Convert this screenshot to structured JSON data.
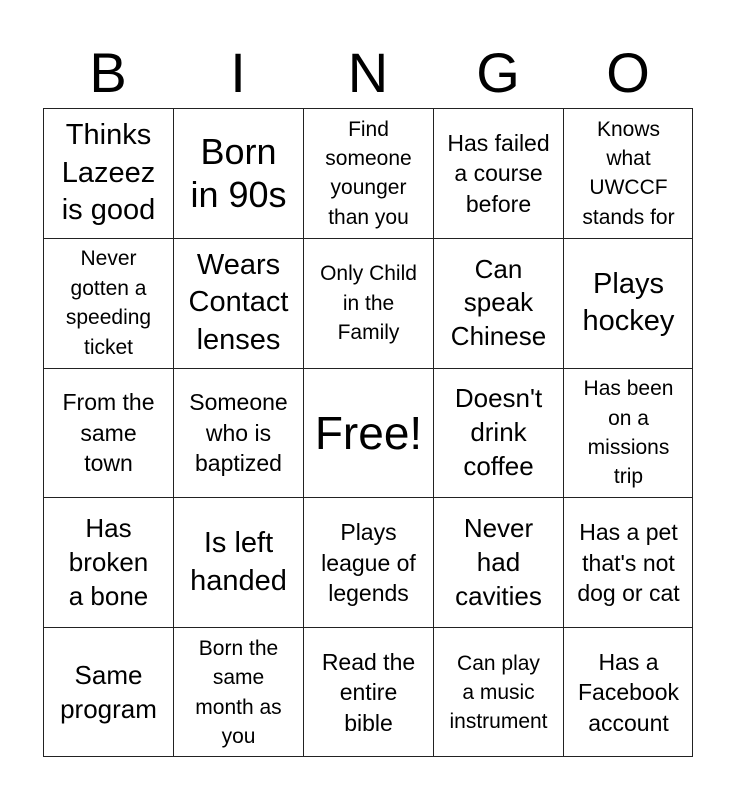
{
  "header": {
    "letters": [
      "B",
      "I",
      "N",
      "G",
      "O"
    ]
  },
  "card": {
    "cells": [
      {
        "text": "Thinks\nLazeez\nis good",
        "size": "s-ml"
      },
      {
        "text": "Born\nin 90s",
        "size": "s-l"
      },
      {
        "text": "Find\nsomeone\nyounger\nthan you",
        "size": "s-xs"
      },
      {
        "text": "Has failed\na course\nbefore",
        "size": "s-s"
      },
      {
        "text": "Knows\nwhat\nUWCCF\nstands for",
        "size": "s-xs"
      },
      {
        "text": "Never\ngotten a\nspeeding\nticket",
        "size": "s-xs"
      },
      {
        "text": "Wears\nContact\nlenses",
        "size": "s-ml"
      },
      {
        "text": "Only Child\nin the\nFamily",
        "size": "s-xs"
      },
      {
        "text": "Can\nspeak\nChinese",
        "size": "s-m"
      },
      {
        "text": "Plays\nhockey",
        "size": "s-ml"
      },
      {
        "text": "From the\nsame\ntown",
        "size": "s-s"
      },
      {
        "text": "Someone\nwho is\nbaptized",
        "size": "s-s"
      },
      {
        "text": "Free!",
        "size": "s-xl"
      },
      {
        "text": "Doesn't\ndrink\ncoffee",
        "size": "s-m"
      },
      {
        "text": "Has been\non a\nmissions\ntrip",
        "size": "s-xs"
      },
      {
        "text": "Has\nbroken\na bone",
        "size": "s-m"
      },
      {
        "text": "Is left\nhanded",
        "size": "s-ml"
      },
      {
        "text": "Plays\nleague of\nlegends",
        "size": "s-s"
      },
      {
        "text": "Never\nhad\ncavities",
        "size": "s-m"
      },
      {
        "text": "Has a pet\nthat's not\ndog or cat",
        "size": "s-s"
      },
      {
        "text": "Same\nprogram",
        "size": "s-m"
      },
      {
        "text": "Born the\nsame\nmonth as\nyou",
        "size": "s-xs"
      },
      {
        "text": "Read the\nentire\nbible",
        "size": "s-s"
      },
      {
        "text": "Can play\na music\ninstrument",
        "size": "s-xs"
      },
      {
        "text": "Has a\nFacebook\naccount",
        "size": "s-s"
      }
    ]
  }
}
